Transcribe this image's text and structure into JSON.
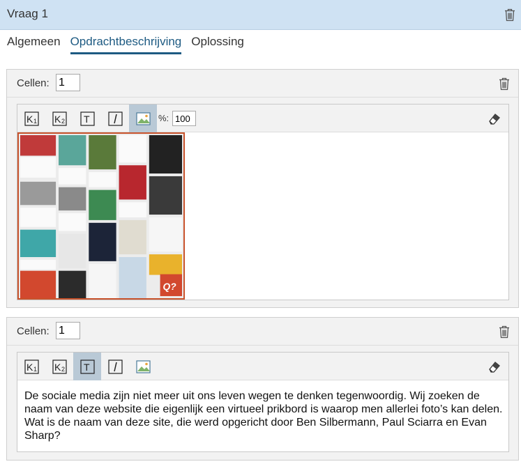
{
  "header": {
    "title": "Vraag 1"
  },
  "tabs": [
    {
      "label": "Algemeen"
    },
    {
      "label": "Opdrachtbeschrijving"
    },
    {
      "label": "Oplossing"
    }
  ],
  "panels": [
    {
      "cells_label": "Cellen:",
      "cells_value": "1",
      "toolbar": {
        "buttons": [
          {
            "icon": "heading-1-icon",
            "label": "K1"
          },
          {
            "icon": "heading-2-icon",
            "label": "K2"
          },
          {
            "icon": "text-icon",
            "label": "T"
          },
          {
            "icon": "italic-icon",
            "label": "I"
          },
          {
            "icon": "image-icon",
            "label": "image",
            "active": true
          }
        ],
        "percent_label": "%:",
        "percent_value": "100"
      },
      "image": {
        "description_icon": "image-thumbnail",
        "badge": "Q?"
      }
    },
    {
      "cells_label": "Cellen:",
      "cells_value": "1",
      "toolbar": {
        "buttons": [
          {
            "icon": "heading-1-icon",
            "label": "K1"
          },
          {
            "icon": "heading-2-icon",
            "label": "K2"
          },
          {
            "icon": "text-icon",
            "label": "T",
            "active": true
          },
          {
            "icon": "italic-icon",
            "label": "I"
          },
          {
            "icon": "image-icon",
            "label": "image"
          }
        ]
      },
      "text": "De sociale media zijn niet meer uit ons leven wegen te denken tegenwoordig. Wij zoeken de naam van deze website die eigenlijk een virtueel prikbord is waarop men allerlei foto’s kan delen. Wat is de naam van deze site, die werd opgericht door Ben Silbermann, Paul Sciarra en Evan Sharp?"
    }
  ],
  "colors": {
    "header_bg": "#cfe2f3",
    "active_tab": "#1d5a82",
    "active_tool": "#b9c9d6",
    "image_border": "#c8522b"
  }
}
